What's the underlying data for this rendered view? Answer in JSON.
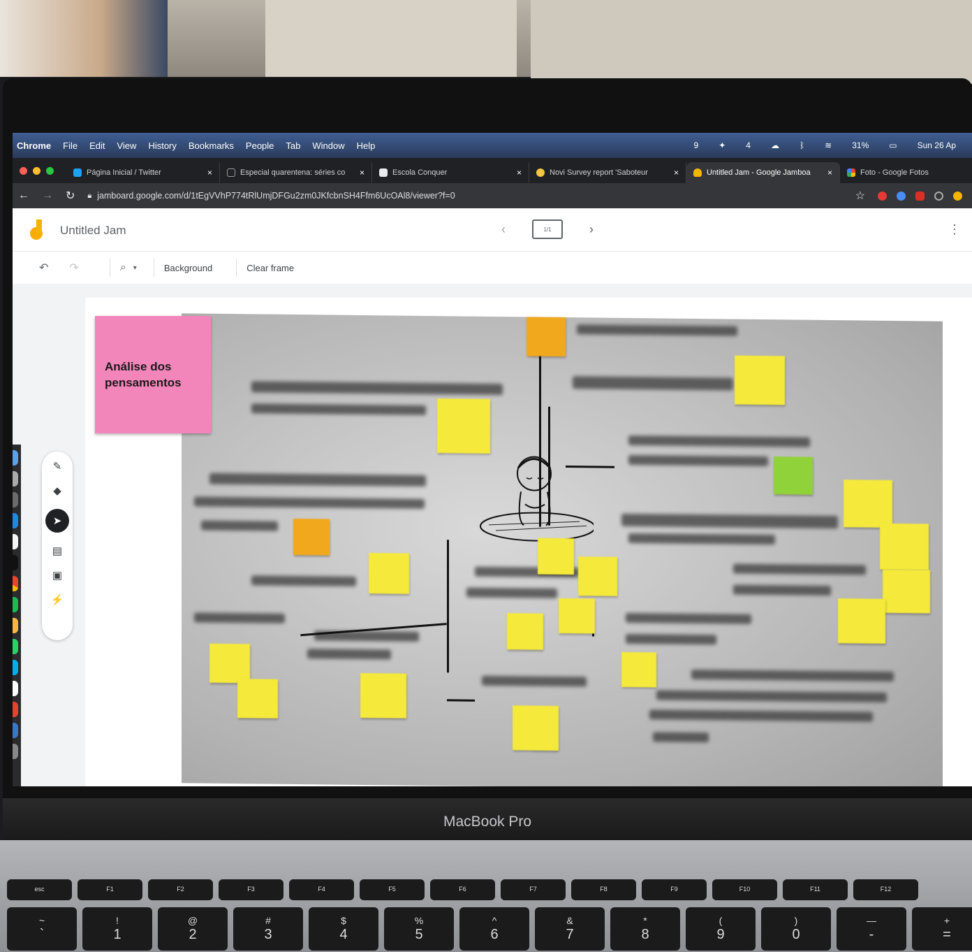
{
  "menubar": {
    "items": [
      "Chrome",
      "File",
      "Edit",
      "View",
      "History",
      "Bookmarks",
      "People",
      "Tab",
      "Window",
      "Help"
    ],
    "status": {
      "counter_a": "9",
      "counter_b": "4",
      "battery": "31%",
      "clock": "Sun 26 Ap"
    }
  },
  "tabs": [
    {
      "title": "Página Inicial / Twitter",
      "color": "#1da1f2",
      "close": "×"
    },
    {
      "title": "Especial quarentena: séries co",
      "color": "#9aa0a6",
      "close": "×"
    },
    {
      "title": "Escola Conquer",
      "color": "#e8eaed",
      "close": "×"
    },
    {
      "title": "Novi Survey report 'Saboteur",
      "color": "#f4c542",
      "close": "×"
    },
    {
      "title": "Untitled Jam - Google Jamboa",
      "color": "#f4b400",
      "close": "×",
      "active": true
    },
    {
      "title": "Foto - Google Fotos",
      "color": "#ea4335",
      "close": ""
    }
  ],
  "address": {
    "url": "jamboard.google.com/d/1tEgVVhP774tRlUmjDFGu2zm0JKfcbnSH4Ffm6UcOAl8/viewer?f=0"
  },
  "jam": {
    "title": "Untitled Jam",
    "frame_indicator": "1/1",
    "toolbar": {
      "background": "Background",
      "clear": "Clear frame"
    }
  },
  "board": {
    "pink_note": "Análise dos pensamentos"
  },
  "laptop": {
    "brand": "MacBook Pro",
    "fn_keys": [
      "esc",
      "F1",
      "F2",
      "F3",
      "F4",
      "F5",
      "F6",
      "F7",
      "F8",
      "F9",
      "F10",
      "F11",
      "F12"
    ],
    "num_keys": [
      [
        "~",
        "`"
      ],
      [
        "!",
        "1"
      ],
      [
        "@",
        "2"
      ],
      [
        "#",
        "3"
      ],
      [
        "$",
        "4"
      ],
      [
        "%",
        "5"
      ],
      [
        "^",
        "6"
      ],
      [
        "&",
        "7"
      ],
      [
        "*",
        "8"
      ],
      [
        "(",
        "9"
      ],
      [
        ")",
        "0"
      ],
      [
        "—",
        "-"
      ],
      [
        "+",
        "="
      ]
    ]
  },
  "colors": {
    "sticky_yellow": "#f5e93b",
    "sticky_orange": "#f2a81d",
    "sticky_green": "#8fd23a",
    "sticky_pink": "#f285b9"
  }
}
